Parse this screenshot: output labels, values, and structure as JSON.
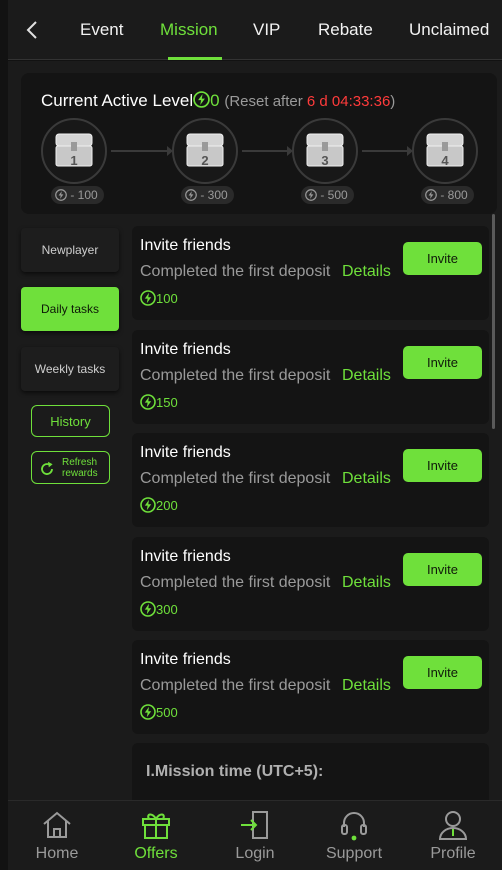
{
  "header": {
    "back_icon": "chevron-left-icon",
    "tabs": [
      {
        "label": "Event",
        "active": false
      },
      {
        "label": "Mission",
        "active": true
      },
      {
        "label": "VIP",
        "active": false
      },
      {
        "label": "Rebate",
        "active": false
      },
      {
        "label": "Unclaimed",
        "active": false
      }
    ]
  },
  "level": {
    "title": "Current Active Level",
    "value": "0",
    "reset_label": "(Reset after ",
    "reset_time": "6 d 04:33:36",
    "reset_close": ")",
    "chests": [
      {
        "number": "1",
        "cost": "- 100"
      },
      {
        "number": "2",
        "cost": "- 300"
      },
      {
        "number": "3",
        "cost": "- 500"
      },
      {
        "number": "4",
        "cost": "- 800"
      }
    ]
  },
  "side_menu": {
    "items": [
      {
        "label": "Newplayer",
        "active": false
      },
      {
        "label": "Daily tasks",
        "active": true
      },
      {
        "label": "Weekly tasks",
        "active": false
      }
    ],
    "history_label": "History",
    "refresh_label_1": "Refresh",
    "refresh_label_2": "rewards"
  },
  "tasks": [
    {
      "title": "Invite friends",
      "description": "Completed the first deposit",
      "details_label": "Details",
      "reward": "100",
      "button_label": "Invite"
    },
    {
      "title": "Invite friends",
      "description": "Completed the first deposit",
      "details_label": "Details",
      "reward": "150",
      "button_label": "Invite"
    },
    {
      "title": "Invite friends",
      "description": "Completed the first deposit",
      "details_label": "Details",
      "reward": "200",
      "button_label": "Invite"
    },
    {
      "title": "Invite friends",
      "description": "Completed the first deposit",
      "details_label": "Details",
      "reward": "300",
      "button_label": "Invite"
    },
    {
      "title": "Invite friends",
      "description": "Completed the first deposit",
      "details_label": "Details",
      "reward": "500",
      "button_label": "Invite"
    }
  ],
  "rules": {
    "heading": "I.Mission time (UTC+5):"
  },
  "bottom_nav": [
    {
      "label": "Home",
      "icon": "home-icon",
      "active": false
    },
    {
      "label": "Offers",
      "icon": "gift-icon",
      "active": true
    },
    {
      "label": "Login",
      "icon": "login-icon",
      "active": false
    },
    {
      "label": "Support",
      "icon": "headset-icon",
      "active": false
    },
    {
      "label": "Profile",
      "icon": "user-icon",
      "active": false
    }
  ],
  "colors": {
    "accent": "#6fe03b",
    "background": "#1b1b1b",
    "timer": "#ff3b3b",
    "muted_text": "#9a9a9a"
  }
}
